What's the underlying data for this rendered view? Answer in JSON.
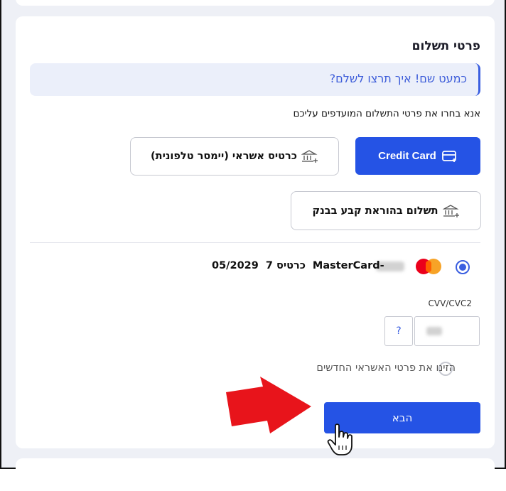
{
  "section": {
    "title": "פרטי תשלום",
    "banner": "כמעט שם! איך תרצו לשלם?",
    "subtitle": "אנא בחרו את פרטי התשלום המועדפים עליכם"
  },
  "payment_methods": {
    "credit_card": "Credit Card",
    "phone_credit": "כרטיס אשראי (יימסר טלפונית)",
    "bank_standing_order": "תשלום בהוראת קבע בבנק"
  },
  "saved_card": {
    "brand": "MasterCard-",
    "card_label": "כרטיס 7",
    "expiry": "05/2029",
    "selected": true
  },
  "cvv": {
    "label": "CVV/CVC2",
    "help": "?"
  },
  "new_card_option": "הזינו את פרטי האשראי החדשים",
  "next_button": "הבא",
  "colors": {
    "primary": "#2553e5",
    "banner_bg": "#ebeffa",
    "annotation_arrow": "#e8141b"
  },
  "icons": {
    "credit_card": "credit-card-icon",
    "bank": "bank-icon",
    "cursor": "hand-pointer-icon"
  }
}
